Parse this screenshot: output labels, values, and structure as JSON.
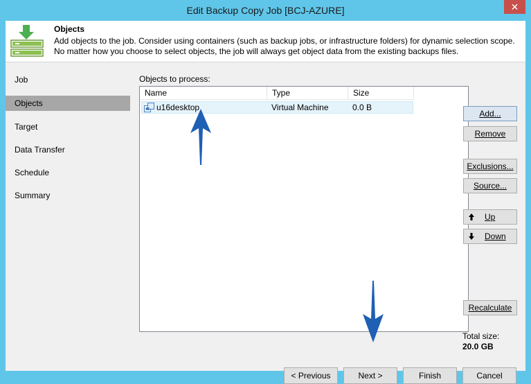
{
  "window": {
    "title": "Edit Backup Copy Job [BCJ-AZURE]",
    "close_glyph": "✕"
  },
  "header": {
    "title": "Objects",
    "description_line1": "Add objects to the job. Consider using containers (such as backup jobs, or infrastructure folders) for dynamic selection scope.",
    "description_line2": "No matter how you choose to select objects, the job will always get object data from the existing backups files.",
    "icon": "backup-copy-icon"
  },
  "nav": {
    "items": [
      {
        "label": "Job"
      },
      {
        "label": "Objects",
        "active": true
      },
      {
        "label": "Target"
      },
      {
        "label": "Data Transfer"
      },
      {
        "label": "Schedule"
      },
      {
        "label": "Summary"
      }
    ]
  },
  "objects": {
    "label": "Objects to process:",
    "columns": [
      "Name",
      "Type",
      "Size"
    ],
    "rows": [
      {
        "name": "u16desktop",
        "type": "Virtual Machine",
        "size": "0.0 B",
        "icon": "vm-icon"
      }
    ]
  },
  "buttons": {
    "add": "Add...",
    "remove": "Remove",
    "exclusions": "Exclusions...",
    "source": "Source...",
    "up": "Up",
    "down": "Down",
    "recalculate": "Recalculate"
  },
  "total": {
    "label": "Total size:",
    "value": "20.0 GB"
  },
  "footer": {
    "previous": "< Previous",
    "next": "Next >",
    "finish": "Finish",
    "cancel": "Cancel"
  },
  "colors": {
    "accent": "#5fc6ea",
    "arrow": "#1f5fb4",
    "selection": "#e5f3fb"
  }
}
